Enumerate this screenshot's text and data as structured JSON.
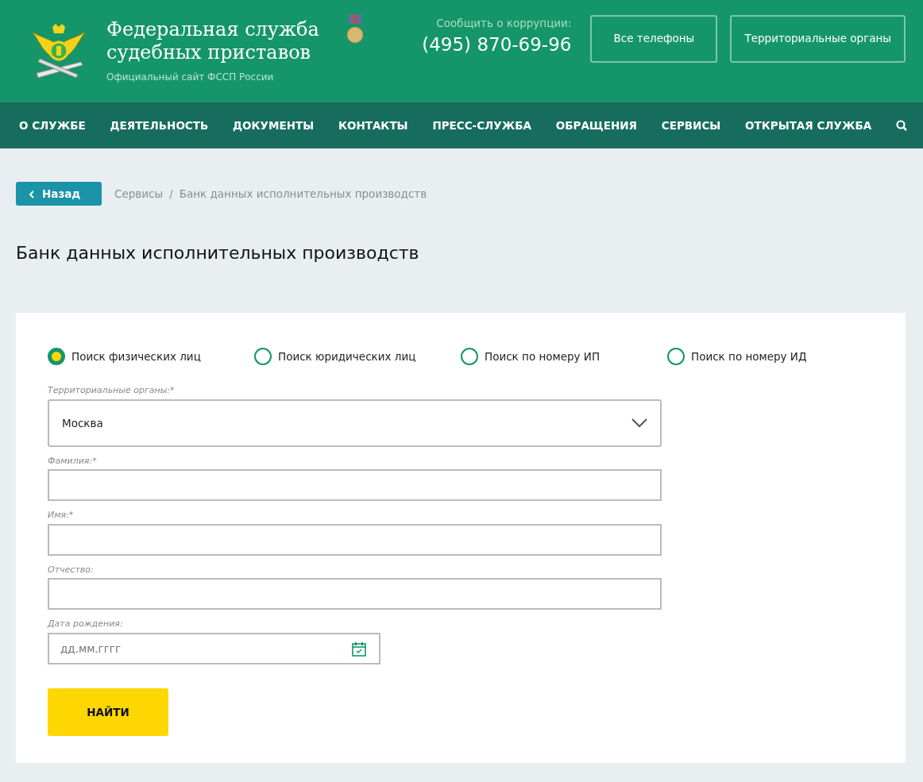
{
  "header": {
    "title": "Федеральная служба судебных приставов",
    "subtitle": "Официальный сайт ФССП России",
    "hotline_label": "Сообщить о коррупции:",
    "hotline_phone": "(495) 870-69-96",
    "buttons": [
      "Все телефоны",
      "Территориальные органы"
    ]
  },
  "nav": {
    "items": [
      "О СЛУЖБЕ",
      "ДЕЯТЕЛЬНОСТЬ",
      "ДОКУМЕНТЫ",
      "КОНТАКТЫ",
      "ПРЕСС-СЛУЖБА",
      "ОБРАЩЕНИЯ",
      "СЕРВИСЫ",
      "ОТКРЫТАЯ СЛУЖБА"
    ]
  },
  "back_button": "Назад",
  "breadcrumb_separator": "/",
  "breadcrumbs": [
    "Сервисы",
    "Банк данных исполнительных производств"
  ],
  "page_title": "Банк данных исполнительных производств",
  "search_modes": [
    {
      "label": "Поиск физических лиц",
      "selected": true
    },
    {
      "label": "Поиск юридических лиц",
      "selected": false
    },
    {
      "label": "Поиск по номеру ИП",
      "selected": false
    },
    {
      "label": "Поиск по номеру ИД",
      "selected": false
    }
  ],
  "fields": [
    {
      "kind": "select",
      "label": "Территориальные органы:*",
      "value": "Москва"
    },
    {
      "kind": "text",
      "label": "Фамилия:*"
    },
    {
      "kind": "text",
      "label": "Имя:*"
    },
    {
      "kind": "text",
      "label": "Отчество:"
    },
    {
      "kind": "date",
      "label": "Дата рождения:",
      "placeholder": "дд.мм.гггг"
    }
  ],
  "submit_button": "НАЙТИ"
}
